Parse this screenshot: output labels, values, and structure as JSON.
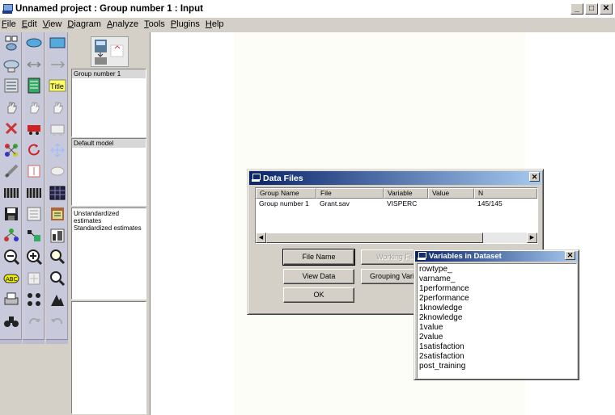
{
  "window": {
    "title": "Unnamed project : Group number 1 : Input",
    "minimize": "_",
    "maximize": "□",
    "close": "✕"
  },
  "menu": [
    "File",
    "Edit",
    "View",
    "Diagram",
    "Analyze",
    "Tools",
    "Plugins",
    "Help"
  ],
  "toolbar": {
    "col1": [
      "draw-observed-variables-icon",
      "draw-latent-variable-icon",
      "draw-indicator-variable-icon",
      "hand-move-icon",
      "erase-icon",
      "preserve-symmetries-icon",
      "fit-to-page-icon",
      "data-files-icon",
      "save-icon",
      "object-properties-icon",
      "zoom-out-icon",
      "zoom-page-icon",
      "print-icon",
      "binoculars-icon"
    ],
    "col2": [
      "draw-unobserved-variable-icon",
      "draw-covariance-icon",
      "list-variables-icon",
      "select-all-icon",
      "move-icon",
      "rotate-icon",
      "touch-up-icon",
      "analysis-properties-icon",
      "text-output-icon",
      "drag-properties-icon",
      "zoom-in-icon",
      "zoom-area-icon",
      "specification-search-icon",
      "redo-icon"
    ],
    "col3": [
      "draw-rectangle-icon",
      "draw-path-icon",
      "title-icon",
      "deselect-all-icon",
      "copy-icon",
      "resize-icon",
      "scroll-icon",
      "calculate-estimates-icon",
      "view-text-icon",
      "copy-to-clipboard-icon",
      "zoom-icon",
      "magnify-icon",
      "degrees-of-freedom-icon",
      "undo-icon"
    ],
    "title_label": "Title"
  },
  "panels": {
    "groups": {
      "selected": "Group number 1"
    },
    "models": {
      "selected": "Default model"
    },
    "outputs": {
      "items": [
        "Unstandardized estimates",
        "Standardized estimates"
      ]
    }
  },
  "data_files": {
    "title": "Data Files",
    "columns": [
      "Group Name",
      "File",
      "Variable",
      "Value",
      "N"
    ],
    "rows": [
      {
        "group": "Group number 1",
        "file": "Grant.sav",
        "variable": "VISPERC",
        "value": "",
        "n": "145/145"
      }
    ],
    "buttons": {
      "file_name": "File Name",
      "working_file": "Working File",
      "view_data": "View Data",
      "grouping_variable": "Grouping Variable",
      "ok": "OK"
    }
  },
  "variables": {
    "title": "Variables in Dataset",
    "items": [
      "rowtype_",
      "varname_",
      "1performance",
      "2performance",
      "1knowledge",
      "2knowledge",
      "1value",
      "2value",
      "1satisfaction",
      "2satisfaction",
      "post_training"
    ]
  },
  "colors": {
    "dialog_title_start": "#0a246a",
    "dialog_title_end": "#a6caf0",
    "toolbar_bg": "#c9c9dc"
  }
}
